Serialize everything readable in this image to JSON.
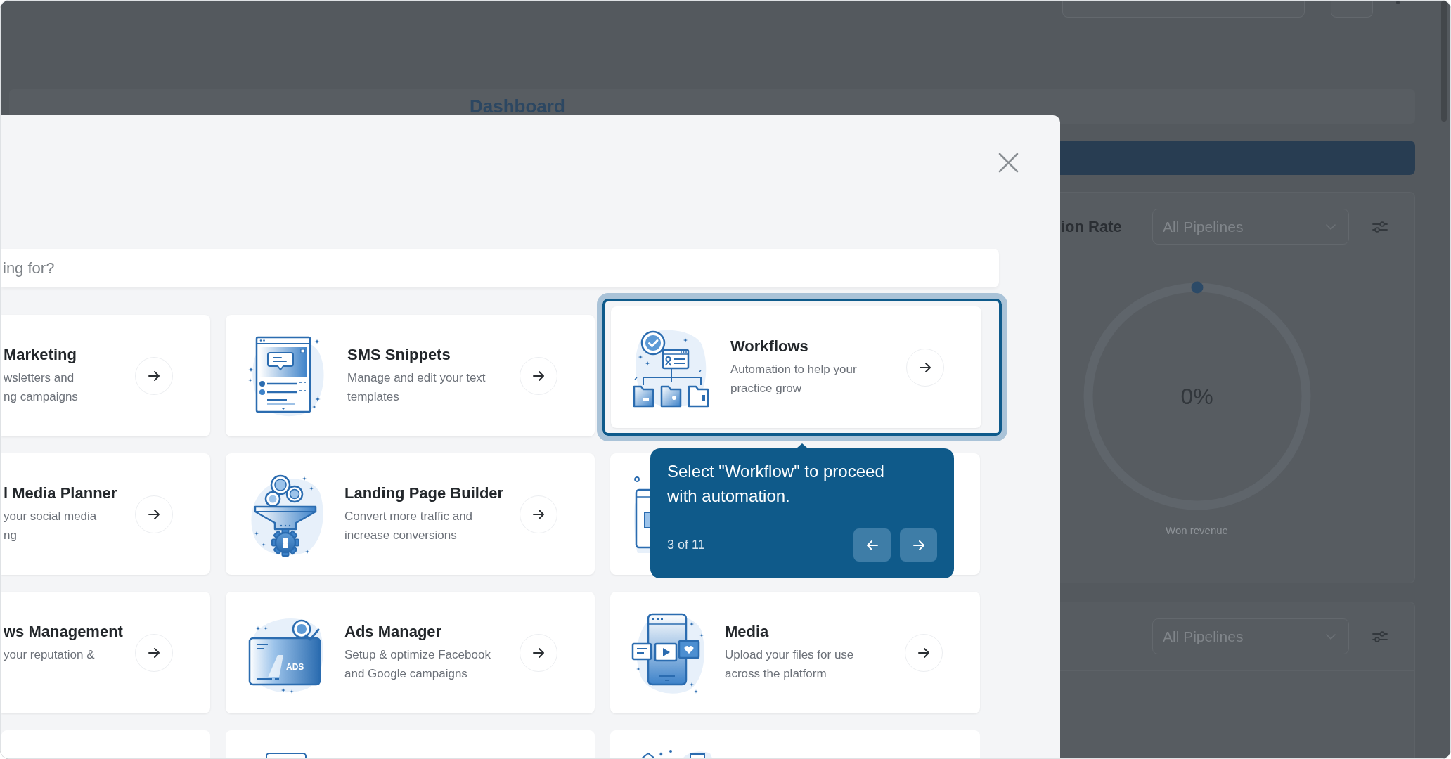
{
  "background": {
    "page_title": "Dashboard",
    "panels": [
      {
        "title": "ion Rate",
        "filter": "All Pipelines",
        "gauge": {
          "level": 0,
          "value": "0%",
          "caption": "Won revenue"
        }
      },
      {
        "filter": "All Pipelines"
      }
    ]
  },
  "modal": {
    "search": {
      "placeholder": "ing for?"
    },
    "cards": [
      {
        "kind": "cut",
        "title": "Marketing",
        "description": [
          "wsletters and",
          "ng campaigns"
        ],
        "highlighted": false
      },
      {
        "kind": "app",
        "title": "SMS Snippets",
        "description": [
          "Manage and edit your text",
          "templates"
        ],
        "highlighted": false
      },
      {
        "kind": "app",
        "title": "Workflows",
        "description": [
          "Automation to help your",
          "practice grow"
        ],
        "highlighted": true
      },
      {
        "kind": "cut",
        "title": "l Media Planner",
        "description": [
          "your social media",
          "ng"
        ],
        "highlighted": false
      },
      {
        "kind": "app",
        "title": "Landing Page Builder",
        "description": [
          "Convert more traffic and",
          "increase conversions"
        ],
        "highlighted": false
      },
      {
        "kind": "covered",
        "highlighted": false
      },
      {
        "kind": "cut",
        "title": "ws Management",
        "description": [
          "your reputation &"
        ],
        "highlighted": false
      },
      {
        "kind": "app",
        "title": "Ads Manager",
        "description": [
          "Setup & optimize Facebook",
          "and Google campaigns"
        ],
        "illustration_label": "ADS",
        "highlighted": false
      },
      {
        "kind": "app",
        "title": "Media",
        "description": [
          "Upload your files for use",
          "across the platform"
        ],
        "highlighted": false
      },
      {
        "kind": "edge",
        "highlighted": false
      },
      {
        "kind": "edge",
        "highlighted": false
      },
      {
        "kind": "edge",
        "highlighted": false
      }
    ]
  },
  "tour": {
    "text": "Select \"Workflow\" to proceed with automation.",
    "step": "3 of 11"
  }
}
